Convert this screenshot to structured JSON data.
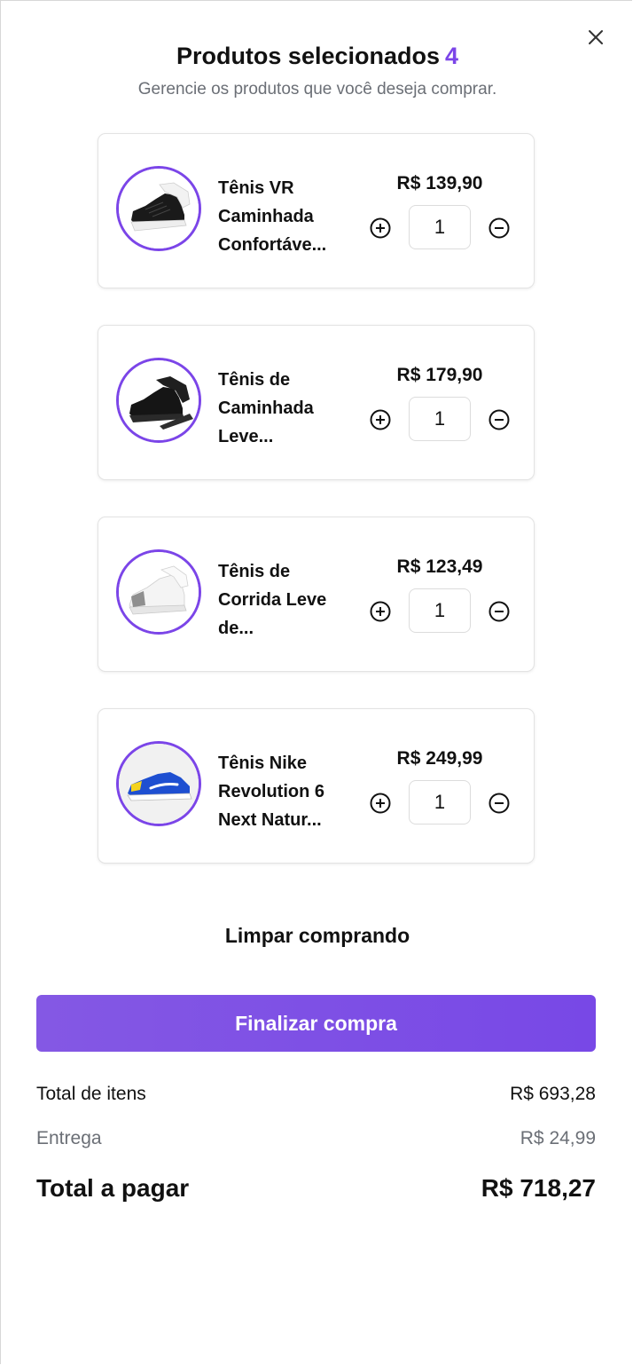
{
  "header": {
    "title": "Produtos selecionados",
    "count": "4",
    "subtitle": "Gerencie os produtos que você deseja comprar."
  },
  "products": [
    {
      "name_lines": [
        "Tênis VR",
        "Caminhada",
        "Confortáve..."
      ],
      "price": "R$ 139,90",
      "quantity": "1",
      "image": "black-sneaker-with-white-sole"
    },
    {
      "name_lines": [
        "Tênis de",
        "Caminhada",
        "Leve..."
      ],
      "price": "R$ 179,90",
      "quantity": "1",
      "image": "all-black-sneaker"
    },
    {
      "name_lines": [
        "Tênis de",
        "Corrida Leve",
        "de..."
      ],
      "price": "R$ 123,49",
      "quantity": "1",
      "image": "white-gray-sneaker"
    },
    {
      "name_lines": [
        "Tênis Nike",
        "Revolution 6",
        "Next Natur..."
      ],
      "price": "R$ 249,99",
      "quantity": "1",
      "image": "blue-yellow-nike-sneaker"
    }
  ],
  "actions": {
    "clear_label": "Limpar comprando",
    "checkout_label": "Finalizar compra"
  },
  "summary": {
    "items_label": "Total de itens",
    "items_value": "R$ 693,28",
    "shipping_label": "Entrega",
    "shipping_value": "R$ 24,99",
    "total_label": "Total a pagar",
    "total_value": "R$ 718,27"
  },
  "icons": {
    "close": "close-icon",
    "increase": "plus-circle-icon",
    "decrease": "minus-circle-icon"
  },
  "colors": {
    "accent": "#7b45e8",
    "muted": "#6b6f76"
  }
}
